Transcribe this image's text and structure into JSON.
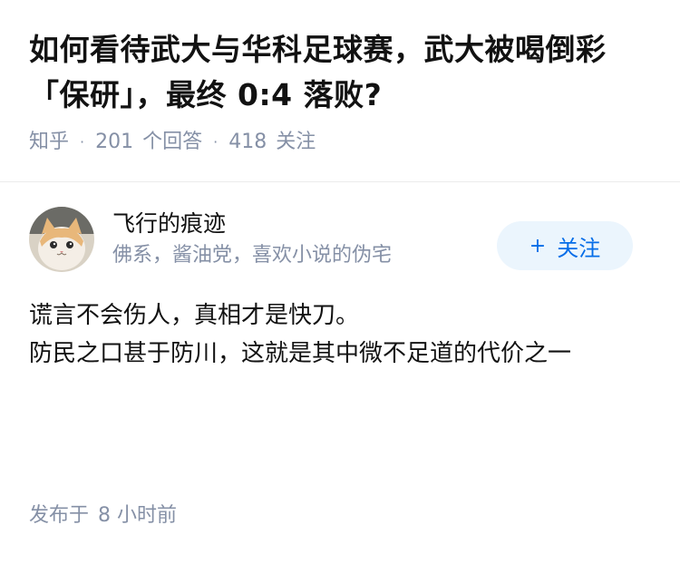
{
  "question": {
    "title_line1": "如何看待武大与华科足球赛，武大被喝倒彩",
    "title_line2": "「保研」，最终 0:4 落败?",
    "source": "知乎",
    "answer_count": "201",
    "answer_label": "个回答",
    "follower_count": "418",
    "follower_label": "关注"
  },
  "answer": {
    "author": {
      "name": "飞行的痕迹",
      "bio": "佛系，酱油党，喜欢小说的伪宅",
      "avatar_icon": "cat-avatar"
    },
    "follow_button": {
      "plus": "+",
      "label": "关注"
    },
    "paragraphs": [
      "谎言不会伤人，真相才是快刀。",
      "防民之口甚于防川，这就是其中微不足道的代价之一"
    ],
    "footer": {
      "published_label": "发布于",
      "time": "8 小时前"
    }
  },
  "colors": {
    "title": "#121212",
    "meta": "#8590a6",
    "follow_bg": "#ebf5fd",
    "follow_text": "#056de8"
  }
}
